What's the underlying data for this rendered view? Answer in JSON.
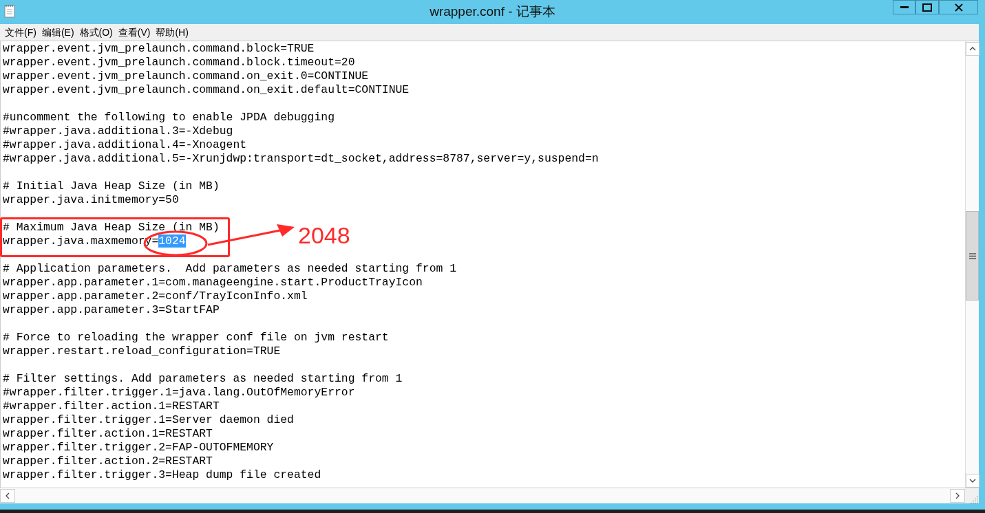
{
  "window": {
    "title": "wrapper.conf - 记事本"
  },
  "menu": [
    "文件(F)",
    "编辑(E)",
    "格式(O)",
    "查看(V)",
    "帮助(H)"
  ],
  "blocks": [
    {
      "lines": [
        {
          "text": "wrapper.event.jvm_prelaunch.command.block=TRUE"
        },
        {
          "text": "wrapper.event.jvm_prelaunch.command.block.timeout=20"
        },
        {
          "text": "wrapper.event.jvm_prelaunch.command.on_exit.0=CONTINUE"
        },
        {
          "text": "wrapper.event.jvm_prelaunch.command.on_exit.default=CONTINUE"
        }
      ]
    },
    {
      "lines": [
        {
          "text": "#uncomment the following to enable JPDA debugging"
        },
        {
          "text": "#wrapper.java.additional.3=-Xdebug"
        },
        {
          "text": "#wrapper.java.additional.4=-Xnoagent"
        },
        {
          "text": "#wrapper.java.additional.5=-Xrunjdwp:transport=dt_socket,address=8787,server=y,suspend=n"
        }
      ]
    },
    {
      "lines": [
        {
          "text": "# Initial Java Heap Size (in MB)"
        },
        {
          "text": "wrapper.java.initmemory=50"
        }
      ]
    },
    {
      "lines": [
        {
          "text": "# Maximum Java Heap Size (in MB)"
        },
        {
          "text": "wrapper.java.maxmemory=",
          "selected_text": "1024"
        }
      ]
    },
    {
      "lines": [
        {
          "text": "# Application parameters.  Add parameters as needed starting from 1"
        },
        {
          "text": "wrapper.app.parameter.1=com.manageengine.start.ProductTrayIcon"
        },
        {
          "text": "wrapper.app.parameter.2=conf/TrayIconInfo.xml"
        },
        {
          "text": "wrapper.app.parameter.3=StartFAP"
        }
      ]
    },
    {
      "lines": [
        {
          "text": "# Force to reloading the wrapper conf file on jvm restart"
        },
        {
          "text": "wrapper.restart.reload_configuration=TRUE"
        }
      ]
    },
    {
      "lines": [
        {
          "text": "# Filter settings. Add parameters as needed starting from 1"
        },
        {
          "text": "#wrapper.filter.trigger.1=java.lang.OutOfMemoryError"
        },
        {
          "text": "#wrapper.filter.action.1=RESTART"
        },
        {
          "text": "wrapper.filter.trigger.1=Server daemon died"
        },
        {
          "text": "wrapper.filter.action.1=RESTART"
        },
        {
          "text": "wrapper.filter.trigger.2=FAP-OUTOFMEMORY"
        },
        {
          "text": "wrapper.filter.action.2=RESTART"
        },
        {
          "text": "wrapper.filter.trigger.3=Heap dump file created"
        }
      ]
    }
  ],
  "annotation": {
    "label": "2048"
  }
}
